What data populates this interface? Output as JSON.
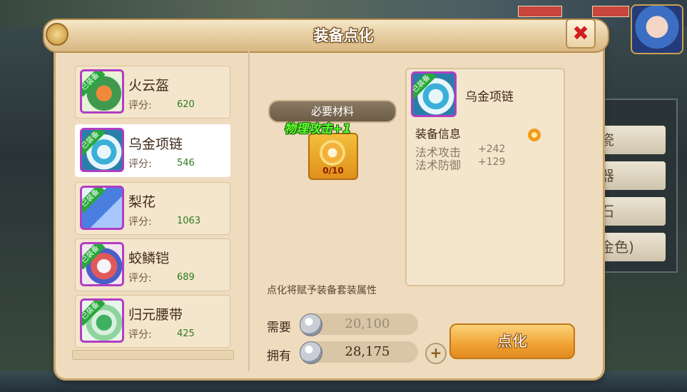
{
  "dialog": {
    "title": "装备点化",
    "close_label": "✖"
  },
  "equip_list": [
    {
      "name": "火云盔",
      "score_label": "评分:",
      "score": "620",
      "badge": "已装备",
      "icon": "helmet-icon",
      "icon_color": "#4aa35a"
    },
    {
      "name": "乌金项链",
      "score_label": "评分:",
      "score": "546",
      "badge": "已装备",
      "icon": "necklace-icon",
      "icon_color": "#3ab0d8"
    },
    {
      "name": "梨花",
      "score_label": "评分:",
      "score": "1063",
      "badge": "已装备",
      "icon": "spear-icon",
      "icon_color": "#4a7fe0"
    },
    {
      "name": "蛟鳞铠",
      "score_label": "评分:",
      "score": "689",
      "badge": "已装备",
      "icon": "armor-icon",
      "icon_color": "#e05a5a"
    },
    {
      "name": "归元腰带",
      "score_label": "评分:",
      "score": "425",
      "badge": "已装备",
      "icon": "belt-icon",
      "icon_color": "#3fb060"
    }
  ],
  "selected_index": 1,
  "material": {
    "banner": "必要材料",
    "bonus": "物理攻击+1",
    "count": "0/10",
    "icon": "swirl-stone-icon"
  },
  "hint": "点化将赋予装备套装属性",
  "info": {
    "name": "乌金项链",
    "header": "装备信息",
    "attrs": [
      {
        "name": "法术攻击",
        "value": "+242"
      },
      {
        "name": "法术防御",
        "value": "+129"
      }
    ]
  },
  "cost": {
    "need_label": "需要",
    "need_value": "20,100",
    "have_label": "拥有",
    "have_value": "28,175",
    "plus_label": "+"
  },
  "action_label": "点化",
  "background": {
    "right_menu": [
      "瓷",
      "器",
      "石",
      "金色)"
    ]
  },
  "colors": {
    "accent": "#f0a232",
    "badge": "#27a83a",
    "score": "#2e7a1f",
    "bonus": "#5dff2d"
  }
}
